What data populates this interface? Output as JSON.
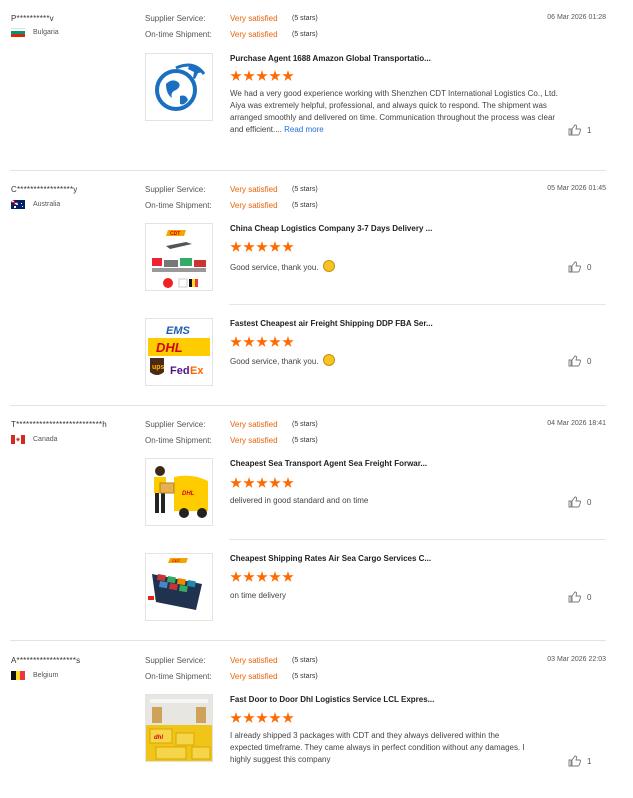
{
  "labels": {
    "supplier_service": "Supplier Service:",
    "ontime_shipment": "On-time Shipment:",
    "read_more": "Read more"
  },
  "reviews": [
    {
      "user": "P**********v",
      "country": "Bulgaria",
      "flag": "bulgaria",
      "date": "06 Mar 2026 01:28",
      "supplier_rating": "Very satisfied",
      "supplier_stars": "(5 stars)",
      "shipment_rating": "Very satisfied",
      "shipment_stars": "(5 stars)",
      "items": [
        {
          "title": "Purchase Agent 1688 Amazon Global Transportatio...",
          "stars": 5,
          "text": "We had a very good experience working with Shenzhen CDT International Logistics Co., Ltd. Aiya was extremely helpful, professional, and always quick to respond. The shipment was arranged smoothly and delivered on time. Communication throughout the process was clear and efficient....",
          "likes": "1",
          "thumb_icon": "globe-plane-logo-icon"
        }
      ]
    },
    {
      "user": "C*****************y",
      "country": "Australia",
      "flag": "australia",
      "date": "05 Mar 2026 01:45",
      "supplier_rating": "Very satisfied",
      "supplier_stars": "(5 stars)",
      "shipment_rating": "Very satisfied",
      "shipment_stars": "(5 stars)",
      "items": [
        {
          "title": "China Cheap Logistics Company 3-7 Days Delivery ...",
          "stars": 5,
          "text": "Good service, thank you.",
          "likes": "0",
          "thumb_icon": "cdt-transport-icon"
        },
        {
          "title": "Fastest Cheapest air Freight Shipping DDP FBA Ser...",
          "stars": 5,
          "text": "Good service, thank you.",
          "likes": "0",
          "thumb_icon": "courier-logos-icon"
        }
      ]
    },
    {
      "user": "T**************************h",
      "country": "Canada",
      "flag": "canada",
      "date": "04 Mar 2026 18:41",
      "supplier_rating": "Very satisfied",
      "supplier_stars": "(5 stars)",
      "shipment_rating": "Very satisfied",
      "shipment_stars": "(5 stars)",
      "items": [
        {
          "title": "Cheapest Sea Transport Agent Sea Freight Forwar...",
          "stars": 5,
          "text": "delivered in good standard and on time",
          "likes": "0",
          "thumb_icon": "dhl-courier-icon"
        },
        {
          "title": "Cheapest Shipping Rates Air Sea Cargo Services C...",
          "stars": 5,
          "text": "on time delivery",
          "likes": "0",
          "thumb_icon": "cargo-ship-icon"
        }
      ]
    },
    {
      "user": "A******************s",
      "country": "Belgium",
      "flag": "belgium",
      "date": "03 Mar 2026 22:03",
      "supplier_rating": "Very satisfied",
      "supplier_stars": "(5 stars)",
      "shipment_rating": "Very satisfied",
      "shipment_stars": "(5 stars)",
      "items": [
        {
          "title": "Fast Door to Door Dhl Logistics Service LCL Expres...",
          "stars": 5,
          "text": "I already shipped 3 packages with CDT and they  always delivered within the expected timeframe. They came always in perfect condition without any damages. I highly suggest this company",
          "likes": "1",
          "thumb_icon": "dhl-warehouse-icon"
        }
      ]
    }
  ],
  "colors": {
    "accent": "#e8630a",
    "star": "#ff6a00",
    "link": "#1e6fdc",
    "divider": "#e3e3e3"
  }
}
